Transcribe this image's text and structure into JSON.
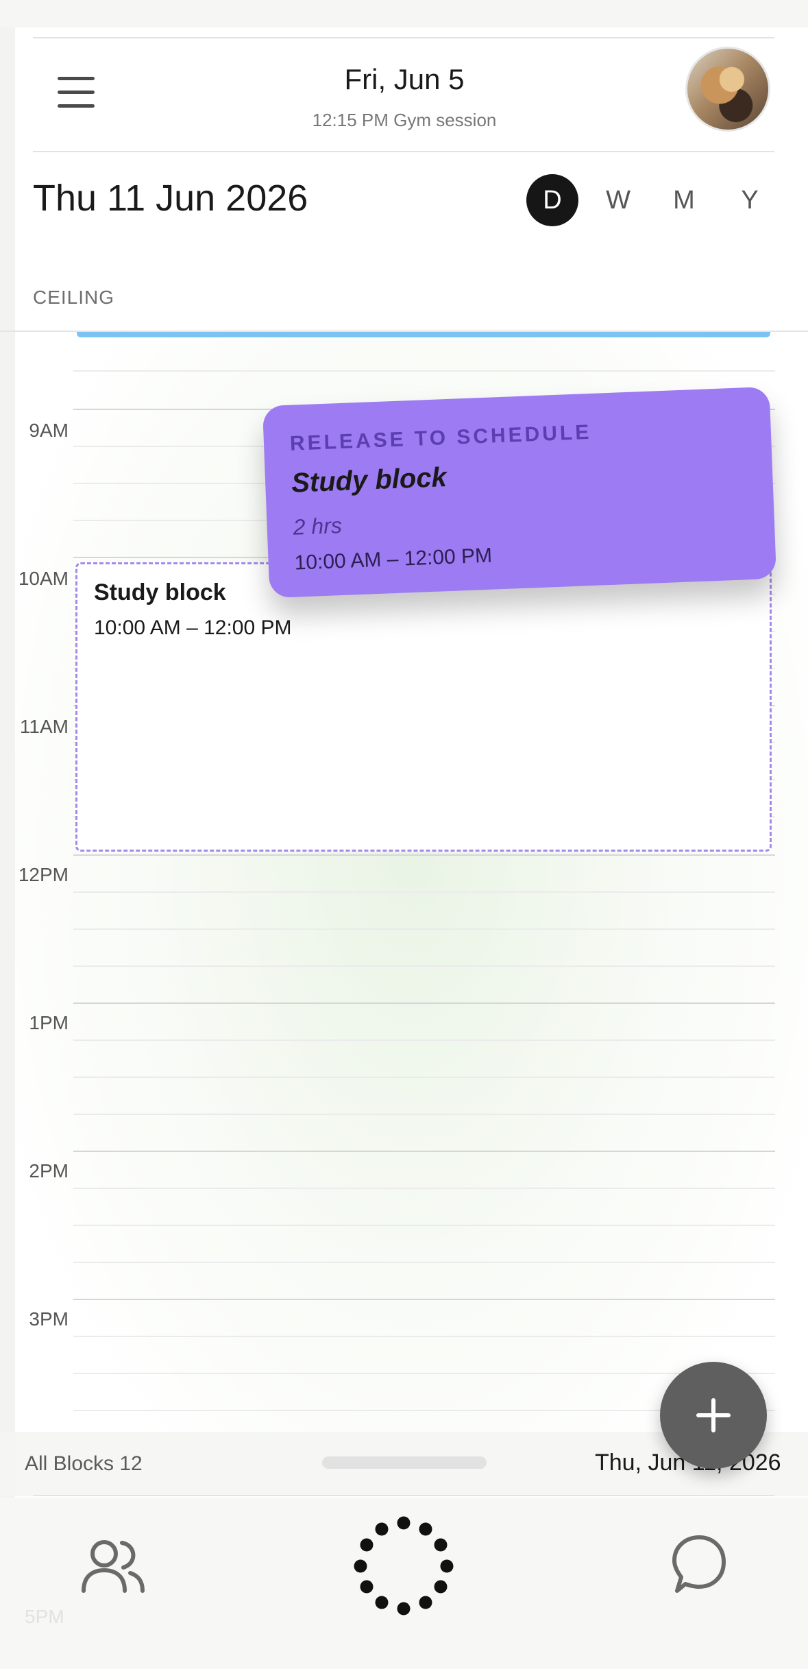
{
  "header": {
    "title": "Fri, Jun 5",
    "subtitle": "12:15 PM Gym session",
    "menu_icon": "hamburger-menu-icon",
    "avatar": "profile-avatar"
  },
  "date_bar": {
    "date": "Thu 11 Jun 2026",
    "views": [
      {
        "label": "D",
        "active": true
      },
      {
        "label": "W",
        "active": false
      },
      {
        "label": "M",
        "active": false
      },
      {
        "label": "Y",
        "active": false
      }
    ]
  },
  "ceiling_label": "CEILING",
  "timeline": {
    "hours": [
      "9AM",
      "10AM",
      "11AM",
      "12PM",
      "1PM",
      "2PM",
      "3PM"
    ],
    "ghost_hour": "5PM"
  },
  "event": {
    "title": "Study block",
    "time": "10:00 AM – 12:00 PM"
  },
  "drag_card": {
    "kicker": "RELEASE TO SCHEDULE",
    "title": "Study block",
    "duration": "2 hrs",
    "time": "10:00 AM – 12:00 PM",
    "color": "#9d7bf2"
  },
  "fab_icon": "plus-icon",
  "footer": {
    "all_blocks": "All Blocks 12",
    "date": "Thu, Jun 11, 2026"
  },
  "tabbar": {
    "left_icon": "people-icon",
    "center_icon": "dotted-ring-icon",
    "right_icon": "chat-bubble-icon"
  },
  "colors": {
    "accent_purple": "#9d7bf2",
    "ceiling_blue": "#7cc2f2",
    "active_view": "#161616"
  }
}
